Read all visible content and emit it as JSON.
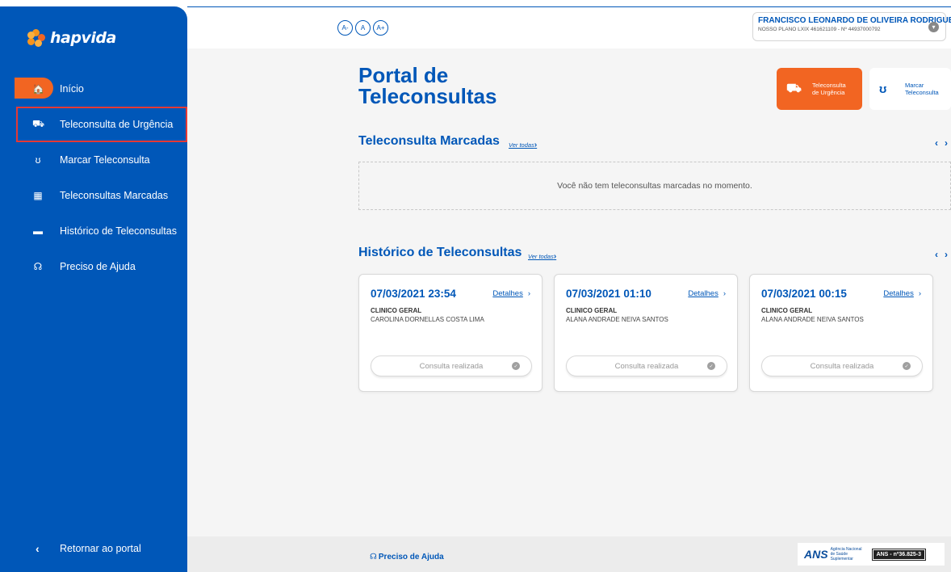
{
  "brand": {
    "name": "hapvida"
  },
  "sidebar": {
    "items": [
      {
        "label": "Início",
        "icon": "home-icon",
        "glyph": "🏠"
      },
      {
        "label": "Teleconsulta de Urgência",
        "icon": "ambulance-icon",
        "glyph": "⛟"
      },
      {
        "label": "Marcar Teleconsulta",
        "icon": "stethoscope-icon",
        "glyph": "ʊ"
      },
      {
        "label": "Teleconsultas Marcadas",
        "icon": "calendar-icon",
        "glyph": "▦"
      },
      {
        "label": "Histórico de Teleconsultas",
        "icon": "id-card-icon",
        "glyph": "▬"
      },
      {
        "label": "Preciso de Ajuda",
        "icon": "headset-icon",
        "glyph": "☊"
      }
    ],
    "back_label": "Retornar ao portal"
  },
  "topbar": {
    "font_controls": [
      "A-",
      "A",
      "A+"
    ],
    "user_name": "FRANCISCO LEONARDO DE OLIVEIRA RODRIGUES",
    "user_plan": "NOSSO PLANO LXIX 461621109 - Nº 44937000792"
  },
  "main": {
    "title": "Portal de Teleconsultas",
    "quick_actions": {
      "urgencia": "Teleconsulta de Urgência",
      "marcar": "Marcar Teleconsulta"
    },
    "marcadas": {
      "title": "Teleconsulta Marcadas",
      "see_all": "Ver todas",
      "empty": "Você não tem teleconsultas marcadas no momento."
    },
    "historico": {
      "title": "Histórico de Teleconsultas",
      "see_all": "Ver todas",
      "details_label": "Detalhes",
      "cards": [
        {
          "date": "07/03/2021 23:54",
          "specialty": "CLINICO GERAL",
          "doctor": "CAROLINA DORNELLAS COSTA LIMA",
          "status": "Consulta realizada"
        },
        {
          "date": "07/03/2021 01:10",
          "specialty": "CLINICO GERAL",
          "doctor": "ALANA ANDRADE NEIVA SANTOS",
          "status": "Consulta realizada"
        },
        {
          "date": "07/03/2021 00:15",
          "specialty": "CLINICO GERAL",
          "doctor": "ALANA ANDRADE NEIVA SANTOS",
          "status": "Consulta realizada"
        }
      ]
    }
  },
  "footer": {
    "help_label": "Preciso de Ajuda",
    "ans_logo": "ANS",
    "ans_agency": "Agência Nacional de Saúde Suplementar",
    "ans_reg": "ANS - nº36.825-3"
  },
  "colors": {
    "primary": "#0057b8",
    "accent": "#f26522",
    "highlight": "#e53935"
  }
}
